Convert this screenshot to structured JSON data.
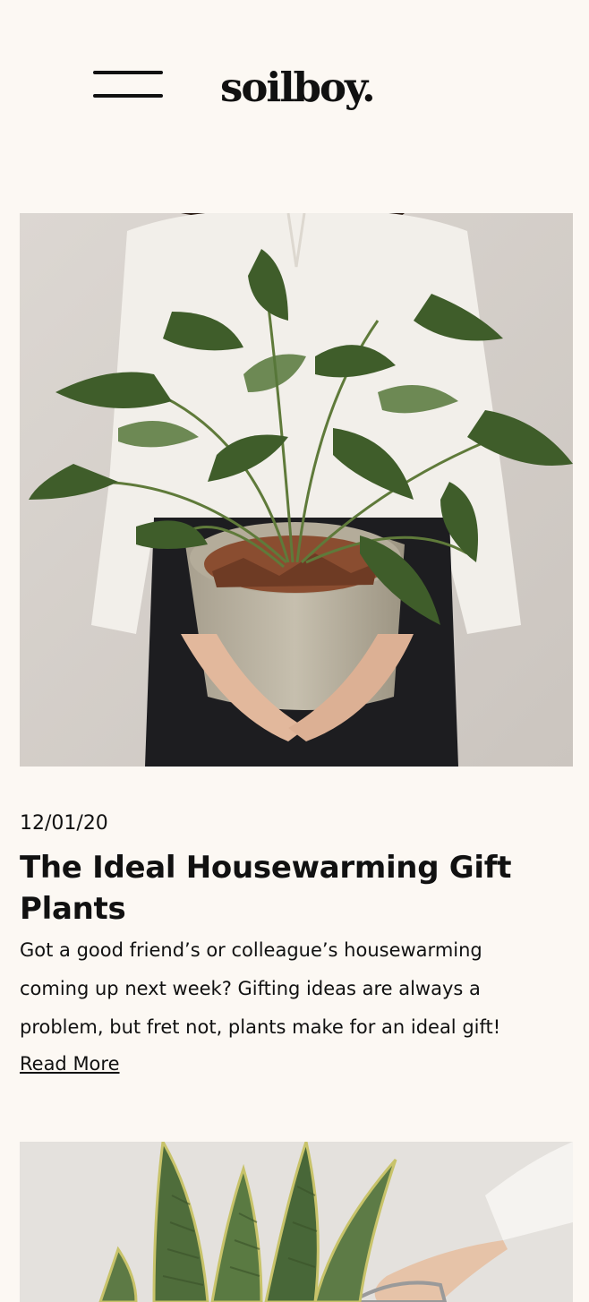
{
  "header": {
    "logo": "soilboy.",
    "menu_icon": "hamburger-menu-icon"
  },
  "posts": [
    {
      "image": "woman-holding-potted-philodendron-plant",
      "date": "12/01/20",
      "title": "The Ideal Housewarming Gift Plants",
      "excerpt": "Got a good friend’s or colleague’s housewarming coming up next week? Gifting ideas are always a problem, but fret not, plants make for an ideal gift!",
      "read_more": "Read More"
    },
    {
      "image": "snake-plant-with-hand-holding-basket"
    }
  ]
}
